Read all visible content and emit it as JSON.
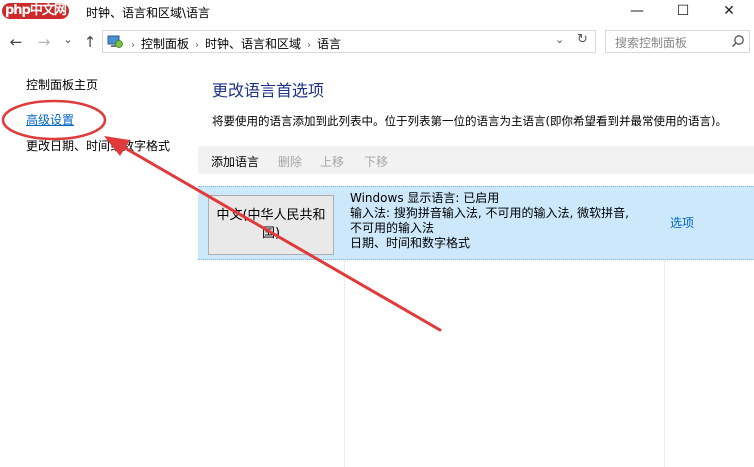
{
  "window": {
    "logo_text": "php中文网",
    "title": "时钟、语言和区域\\语言",
    "minimize_glyph": "—",
    "maximize_glyph": "☐",
    "close_glyph": "✕"
  },
  "nav": {
    "back_glyph": "←",
    "forward_glyph": "→",
    "recent_glyph": "⌄",
    "up_glyph": "↑"
  },
  "address": {
    "crumbs": [
      "控制面板",
      "时钟、语言和区域",
      "语言"
    ],
    "sep_glyph": "›",
    "dropdown_glyph": "⌄",
    "refresh_glyph": "↻"
  },
  "search": {
    "placeholder": "搜索控制面板"
  },
  "sidebar": {
    "home": "控制面板主页",
    "advanced": "高级设置",
    "date_format": "更改日期、时间或数字格式"
  },
  "main": {
    "title": "更改语言首选项",
    "description": "将要使用的语言添加到此列表中。位于列表第一位的语言为主语言(即你希望看到并最常使用的语言)。",
    "toolbar": {
      "add": "添加语言",
      "remove": "删除",
      "up": "上移",
      "down": "下移"
    },
    "languages": [
      {
        "name": "中文(中华人民共和国)",
        "details": [
          "Windows 显示语言: 已启用",
          "输入法: 搜狗拼音输入法, 不可用的输入法, 微软拼音,",
          "不可用的输入法",
          "日期、时间和数字格式"
        ],
        "options_label": "选项"
      }
    ]
  },
  "colors": {
    "link": "#0066cc",
    "title": "#1e3287",
    "selection": "#cde8fb",
    "annotation": "#e03a3a"
  }
}
